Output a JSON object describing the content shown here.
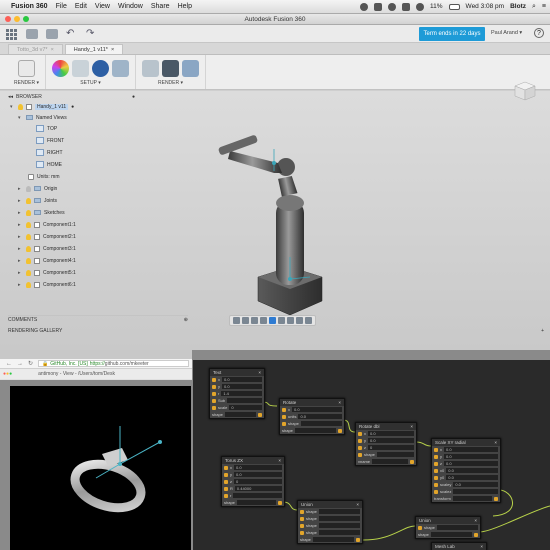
{
  "menubar": {
    "app_name": "Fusion 360",
    "items": [
      "File",
      "Edit",
      "View",
      "Window",
      "Share",
      "Help"
    ],
    "battery": "11%",
    "clock": "Wed 3:08 pm",
    "user": "Blotz"
  },
  "window": {
    "title": "Autodesk Fusion 360",
    "term_notice": "Term ends in 22 days",
    "account": "Paul Arand ▾",
    "help": "?"
  },
  "tabs": [
    {
      "label": "Totto_3d v7*"
    },
    {
      "label": "Handy_1 v11*"
    }
  ],
  "ribbon": {
    "groups": [
      {
        "label": "RENDER ▾"
      },
      {
        "label": "SETUP ▾"
      },
      {
        "label": "RENDER ▾"
      }
    ]
  },
  "browser": {
    "header": "BROWSER",
    "root": "Handy_1 v11",
    "named_views": "Named Views",
    "views": [
      "TOP",
      "FRONT",
      "RIGHT",
      "HOME"
    ],
    "units": "Units: mm",
    "items": [
      "Origin",
      "Joints",
      "Sketches",
      "Component1:1",
      "Component2:1",
      "Component3:1",
      "Component4:1",
      "Component5:1",
      "Component6:1"
    ]
  },
  "comments": {
    "label": "COMMENTS"
  },
  "rendering_gallery": {
    "label": "RENDERING GALLERY"
  },
  "chrome": {
    "tab_title": "antimony - View - /Users/tom/Desk",
    "secure_label": "GitHub, Inc. [US]",
    "url_scheme": "https://",
    "url_rest": "github.com/mkeeter"
  },
  "node_editor": {
    "nodes": [
      {
        "title": "Text",
        "rows": [
          "x",
          "y",
          "r",
          "Sub",
          "scale",
          "shape"
        ],
        "vals": [
          "0.0",
          "0.0",
          "1.4",
          "",
          "0",
          ""
        ]
      },
      {
        "title": "Rotate",
        "rows": [
          "x",
          "units",
          "shape",
          "shape"
        ],
        "vals": [
          "0.0",
          "0.0",
          "",
          ""
        ]
      },
      {
        "title": "Rotate dbl",
        "rows": [
          "x",
          "y",
          "z",
          "shape",
          "vname"
        ],
        "vals": [
          "0.0",
          "0.0",
          "0",
          "",
          ""
        ]
      },
      {
        "title": "Torus ZX",
        "rows": [
          "x",
          "y",
          "z",
          "R",
          "r",
          "shape"
        ],
        "vals": [
          "0.0",
          "0.0",
          "0",
          "0.44000",
          "",
          ""
        ]
      },
      {
        "title": "Union",
        "rows": [
          "shape",
          "shape",
          "shape",
          "shape",
          "shape"
        ],
        "vals": [
          "",
          "",
          "",
          "",
          ""
        ]
      },
      {
        "title": "Scale XY radial",
        "rows": [
          "x",
          "y",
          "z",
          "x0",
          "y0",
          "scaley",
          "scalez",
          "transform"
        ],
        "vals": [
          "0.0",
          "0.0",
          "0.0",
          "0.0",
          "0.0",
          "0.0",
          "",
          "",
          ""
        ]
      },
      {
        "title": "Union",
        "rows": [
          "shape",
          "shape"
        ],
        "vals": [
          "",
          ""
        ]
      },
      {
        "title": "Mesh Lab",
        "rows": [
          "x"
        ],
        "vals": [
          ""
        ]
      }
    ]
  },
  "colors": {
    "accent": "#1e9bd7",
    "node_port": "#e2a52b",
    "wire": "#b8d24a"
  }
}
